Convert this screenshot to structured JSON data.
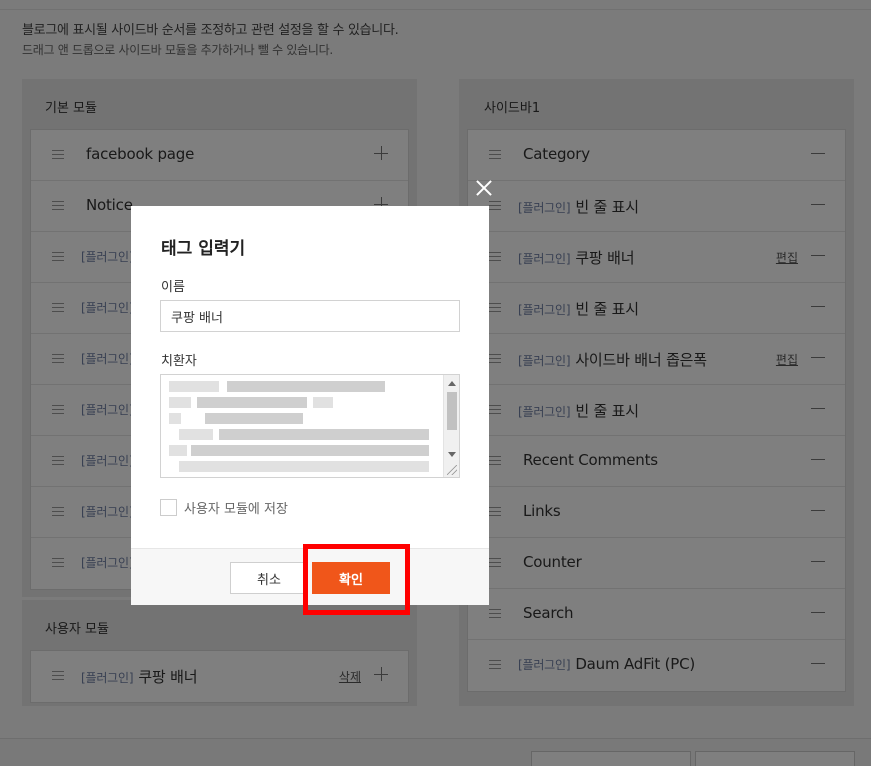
{
  "description": {
    "line1": "블로그에 표시될 사이드바 순서를 조정하고 관련 설정을 할 수 있습니다.",
    "line2": "드래그 앤 드롭으로 사이드바 모듈을 추가하거나 뺄 수 있습니다."
  },
  "basic_modules": {
    "title": "기본 모듈",
    "items": [
      {
        "label": "facebook page",
        "plugin": ""
      },
      {
        "label": "Notice",
        "plugin": ""
      },
      {
        "label": "",
        "plugin": "[플러그인]"
      },
      {
        "label": "",
        "plugin": "[플러그인]"
      },
      {
        "label": "",
        "plugin": "[플러그인]"
      },
      {
        "label": "",
        "plugin": "[플러그인]"
      },
      {
        "label": "",
        "plugin": "[플러그인]"
      },
      {
        "label": "",
        "plugin": "[플러그인]"
      },
      {
        "label": "",
        "plugin": "[플러그인]"
      }
    ]
  },
  "user_modules": {
    "title": "사용자 모듈",
    "items": [
      {
        "plugin": "[플러그인]",
        "label": "쿠팡 배너",
        "delete_label": "삭제"
      }
    ]
  },
  "sidebar1": {
    "title": "사이드바1",
    "items": [
      {
        "plugin": "",
        "label": "Category",
        "edit": ""
      },
      {
        "plugin": "[플러그인]",
        "label": "빈 줄 표시",
        "edit": ""
      },
      {
        "plugin": "[플러그인]",
        "label": "쿠팡 배너",
        "edit": "편집"
      },
      {
        "plugin": "[플러그인]",
        "label": "빈 줄 표시",
        "edit": ""
      },
      {
        "plugin": "[플러그인]",
        "label": "사이드바 배너 좁은폭",
        "edit": "편집"
      },
      {
        "plugin": "[플러그인]",
        "label": "빈 줄 표시",
        "edit": ""
      },
      {
        "plugin": "",
        "label": "Recent Comments",
        "edit": ""
      },
      {
        "plugin": "",
        "label": "Links",
        "edit": ""
      },
      {
        "plugin": "",
        "label": "Counter",
        "edit": ""
      },
      {
        "plugin": "",
        "label": "Search",
        "edit": ""
      },
      {
        "plugin": "[플러그인]",
        "label": "Daum AdFit (PC)",
        "edit": ""
      }
    ]
  },
  "modal": {
    "title": "태그 입력기",
    "name_label": "이름",
    "name_value": "쿠팡 배너",
    "code_label": "치환자",
    "save_checkbox_label": "사용자 모듈에 저장",
    "cancel_label": "취소",
    "confirm_label": "확인"
  },
  "colors": {
    "accent": "#f0561a",
    "highlight": "#ff0000",
    "plugin_tag": "#6f7fa4"
  }
}
